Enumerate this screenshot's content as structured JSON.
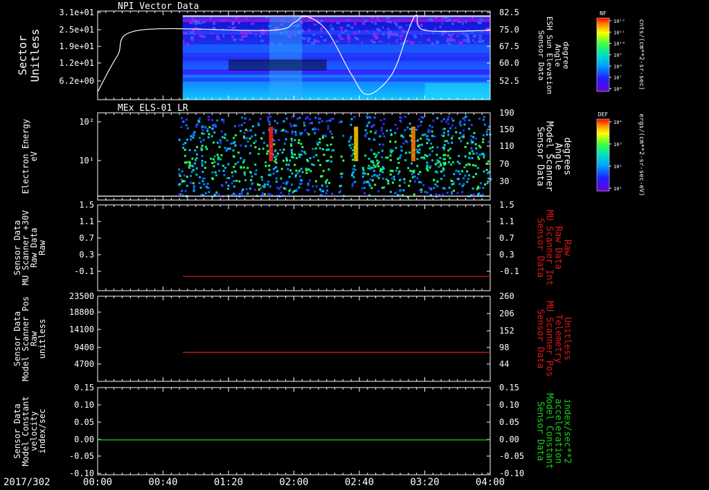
{
  "colors": {
    "background": "#000000",
    "axes": "#ffffff",
    "red_series": "#e01818",
    "green_series": "#19d219",
    "white_series": "#ffffff"
  },
  "panels": [
    {
      "title": "NPI Vector Data",
      "type": "heatmap",
      "left_axis": {
        "label_lines": [
          "Sector",
          "Unitless"
        ],
        "ticks": [
          "3.1e+01",
          "2.5e+01",
          "1.9e+01",
          "1.2e+01",
          "6.2e+00"
        ]
      },
      "right_axis": {
        "label_lines": [
          "Sensor Data",
          "ESH Sun Elevation",
          "Angle",
          "degree"
        ],
        "ticks": [
          "82.5",
          "75.0",
          "67.5",
          "60.0",
          "52.5"
        ]
      },
      "colorbar": {
        "title": "NF",
        "ticks": [
          "10¹²",
          "10¹¹",
          "10¹⁰",
          "10⁹",
          "10⁸",
          "10⁷",
          "10⁶"
        ],
        "label": "cnts/(cm**2-sr-sec)"
      }
    },
    {
      "title": "MEx ELS-01 LR",
      "type": "heatmap",
      "left_axis": {
        "label_lines": [
          "Electron Energy",
          "eV"
        ],
        "ticks": [
          "10²",
          "10¹"
        ]
      },
      "right_axis": {
        "label_lines": [
          "Sensor Data",
          "Model Scanner",
          "Angle",
          "degrees"
        ],
        "ticks": [
          "190",
          "150",
          "110",
          "70",
          "30"
        ]
      },
      "colorbar": {
        "title": "DEF",
        "ticks": [
          "10⁴",
          "10³",
          "10²",
          "10¹"
        ],
        "label": "ergs/(cm**2-sr-sec-eV)"
      }
    },
    {
      "title": "",
      "type": "line",
      "left_axis": {
        "label_lines": [
          "Sensor Data",
          "MU Scanner +30V",
          "Raw Data",
          "Raw"
        ],
        "ticks": [
          "1.5",
          "1.1",
          "0.7",
          "0.3",
          "-0.1"
        ]
      },
      "right_axis": {
        "label_lines": [
          "Sensor Data",
          "MU Scanner Int",
          "Raw Data",
          "Raw"
        ],
        "ticks": [
          "1.5",
          "1.1",
          "0.7",
          "0.3",
          "-0.1"
        ]
      }
    },
    {
      "title": "",
      "type": "line",
      "left_axis": {
        "label_lines": [
          "Sensor Data",
          "Model Scanner Pos",
          "Raw",
          "unitless"
        ],
        "ticks": [
          "23500",
          "18800",
          "14100",
          "9400",
          "4700"
        ]
      },
      "right_axis": {
        "label_lines": [
          "Sensor Data",
          "MU Scanner Pos",
          "Telemetry",
          "Unitless"
        ],
        "ticks": [
          "260",
          "206",
          "152",
          "98",
          "44"
        ]
      }
    },
    {
      "title": "",
      "type": "line",
      "left_axis": {
        "label_lines": [
          "Sensor Data",
          "Model Constant",
          "velocity",
          "index/sec"
        ],
        "ticks": [
          "0.15",
          "0.10",
          "0.05",
          "0.00",
          "-0.05",
          "-0.10"
        ]
      },
      "right_axis": {
        "label_lines": [
          "Sensor Data",
          "Model Constant",
          "acceleration",
          "index/sec**2"
        ],
        "ticks": [
          "0.15",
          "0.10",
          "0.05",
          "0.00",
          "-0.05",
          "-0.10"
        ]
      }
    }
  ],
  "x_axis": {
    "date": "2017/302",
    "ticks": [
      "00:00",
      "00:40",
      "01:20",
      "02:00",
      "02:40",
      "03:20",
      "04:00"
    ]
  },
  "chart_data": [
    {
      "type": "line",
      "title": "NPI Vector Data",
      "series": [
        {
          "color": "#ffffff",
          "x": [
            "00:00",
            "00:12",
            "00:25",
            "01:45",
            "02:00",
            "02:07",
            "02:20",
            "02:35",
            "02:45",
            "03:00",
            "03:10",
            "03:15",
            "03:20",
            "04:00"
          ],
          "y": [
            51.0,
            65.0,
            75.0,
            75.0,
            78.0,
            80.5,
            75.0,
            58.0,
            50.0,
            58.0,
            75.0,
            81.0,
            75.0,
            75.0
          ]
        }
      ],
      "ylim": [
        48,
        82.5
      ]
    },
    {
      "type": "line",
      "title": "MEx ELS-01 LR",
      "series": [
        {
          "color": "#ffffff",
          "x": [
            "00:00",
            "04:00"
          ],
          "y": [
            18,
            18
          ]
        }
      ],
      "ylim": [
        10,
        190
      ]
    },
    {
      "type": "line",
      "series": [
        {
          "color": "#e01818",
          "x": [
            "00:52",
            "04:00"
          ],
          "y": [
            0.0,
            0.0
          ]
        }
      ],
      "ylim": [
        -0.3,
        1.5
      ]
    },
    {
      "type": "line",
      "series": [
        {
          "color": "#e01818",
          "x": [
            "00:52",
            "04:00"
          ],
          "y": [
            8000,
            8000
          ]
        }
      ],
      "ylim": [
        0,
        23500
      ]
    },
    {
      "type": "line",
      "series": [
        {
          "color": "#19d219",
          "x": [
            "00:00",
            "04:00"
          ],
          "y": [
            0.0,
            0.0
          ]
        }
      ],
      "ylim": [
        -0.1,
        0.15
      ]
    }
  ]
}
